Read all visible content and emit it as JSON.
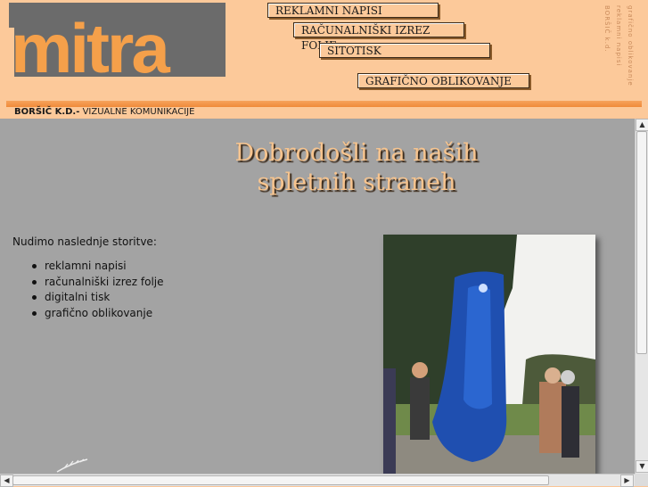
{
  "header": {
    "logo_text": "mitra",
    "nav": [
      {
        "label": "REKLAMNI NAPISI"
      },
      {
        "label": "RAČUNALNIŠKI IZREZ FOLJE"
      },
      {
        "label": "SITOTISK"
      },
      {
        "label": "GRAFIČNO OBLIKOVANJE"
      }
    ],
    "vertical_text": [
      "BORŠIČ k.d.",
      "reklamni napisi",
      "grafično oblikovanje"
    ],
    "company_name": "BORŠIČ K.D.-",
    "company_tagline": "VIZUALNE KOMUNIKACIJE"
  },
  "main": {
    "welcome_line1": "Dobrodošli na naših",
    "welcome_line2": "spletnih straneh",
    "intro": "Nudimo naslednje storitve:",
    "services": [
      "reklamni napisi",
      "računalniški izrez folje",
      "digitalni tisk",
      "grafično oblikovanje"
    ]
  },
  "colors": {
    "header_bg": "#fcc99a",
    "logo_orange": "#f5a04a",
    "logo_gray": "#6b6b6b",
    "main_bg": "#a3a3a3",
    "welcome_text": "#f7c48e"
  },
  "icons": {
    "scroll_up": "triangle-up",
    "scroll_down": "triangle-down",
    "scroll_left": "triangle-left",
    "scroll_right": "triangle-right"
  }
}
